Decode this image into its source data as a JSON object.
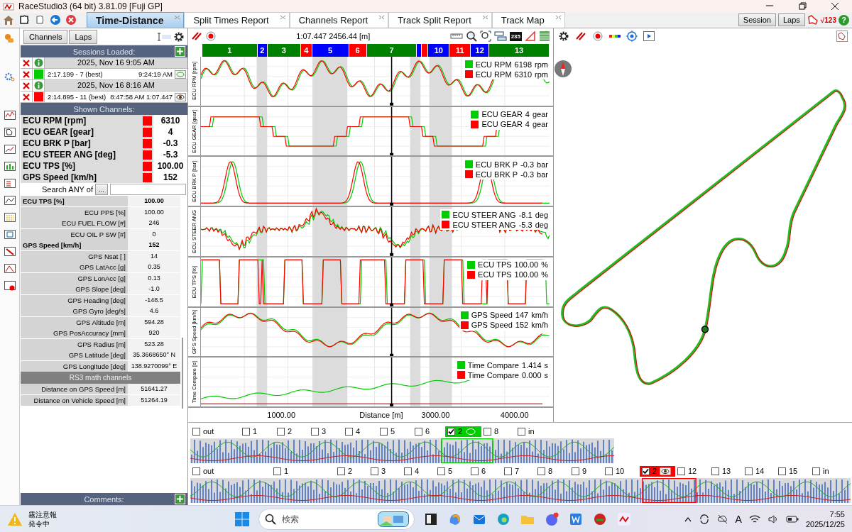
{
  "window": {
    "title": "RaceStudio3 (64 bit) 3.81.09 [Fuji GP]"
  },
  "tabs": [
    {
      "label": "Time-Distance",
      "selected": true
    },
    {
      "label": "Split Times Report",
      "selected": false
    },
    {
      "label": "Channels Report",
      "selected": false
    },
    {
      "label": "Track Split Report",
      "selected": false
    },
    {
      "label": "Track Map",
      "selected": false
    }
  ],
  "top_right": {
    "buttons": [
      "Session",
      "Laps"
    ],
    "math_label": "√123",
    "help_label": "?"
  },
  "left_panel": {
    "buttons": [
      "Channels",
      "Laps"
    ],
    "sessions_header": "Sessions Loaded:",
    "sessions": [
      {
        "kind": "session",
        "date": "2025, Nov 16 9:05 AM"
      },
      {
        "kind": "lap",
        "color": "#00cc00",
        "lap": "2:17.199 - 7 (best)",
        "time": "9:24:19 AM"
      },
      {
        "kind": "session",
        "date": "2025, Nov 16 8:16 AM"
      },
      {
        "kind": "lap",
        "color": "#ff0000",
        "lap": "2:14.895 - 11 (best)",
        "time": "8:47:58 AM 1:07.447"
      }
    ],
    "channels_header": "Shown Channels:",
    "shown_channels": [
      {
        "name": "ECU RPM [rpm]",
        "color": "#ff0000",
        "value": "6310"
      },
      {
        "name": "ECU GEAR [gear]",
        "color": "#ff0000",
        "value": "4"
      },
      {
        "name": "ECU BRK P [bar]",
        "color": "#ff0000",
        "value": "-0.3"
      },
      {
        "name": "ECU STEER ANG [deg]",
        "color": "#ff0000",
        "value": "-5.3"
      },
      {
        "name": "ECU TPS [%]",
        "color": "#ff0000",
        "value": "100.00"
      },
      {
        "name": "GPS Speed [km/h]",
        "color": "#ff0000",
        "value": "152"
      }
    ],
    "search": {
      "label": "Search ANY of",
      "button": "..."
    },
    "channel_values": [
      {
        "kind": "group",
        "name": "ECU TPS [%]",
        "value": "100.00"
      },
      {
        "kind": "item",
        "name": "ECU PPS [%]",
        "value": "100.00"
      },
      {
        "kind": "item",
        "name": "ECU FUEL FLOW [#]",
        "value": "246"
      },
      {
        "kind": "item",
        "name": "ECU OIL P SW [#]",
        "value": "0"
      },
      {
        "kind": "group",
        "name": "GPS Speed [km/h]",
        "value": "152"
      },
      {
        "kind": "item",
        "name": "GPS Nsat [ ]",
        "value": "14"
      },
      {
        "kind": "item",
        "name": "GPS LatAcc [g]",
        "value": "0.35"
      },
      {
        "kind": "item",
        "name": "GPS LonAcc [g]",
        "value": "0.13"
      },
      {
        "kind": "item",
        "name": "GPS Slope [deg]",
        "value": "-1.0"
      },
      {
        "kind": "item",
        "name": "GPS Heading [deg]",
        "value": "-148.5"
      },
      {
        "kind": "item",
        "name": "GPS Gyro [deg/s]",
        "value": "4.6"
      },
      {
        "kind": "item",
        "name": "GPS Altitude [m]",
        "value": "594.28"
      },
      {
        "kind": "item",
        "name": "GPS PosAccuracy [mm]",
        "value": "920"
      },
      {
        "kind": "item",
        "name": "GPS Radius [m]",
        "value": "523.28"
      },
      {
        "kind": "item",
        "name": "GPS Latitude [deg]",
        "value": "35.3668650° N"
      },
      {
        "kind": "item",
        "name": "GPS Longitude [deg]",
        "value": "138.9270099° E"
      },
      {
        "kind": "section",
        "name": "RS3 math channels"
      },
      {
        "kind": "item",
        "name": "Distance on GPS Speed [m]",
        "value": "51641.27"
      },
      {
        "kind": "item",
        "name": "Distance on Vehicle Speed [m]",
        "value": "51264.19"
      }
    ],
    "comments_header": "Comments:"
  },
  "chart": {
    "cursor": "1:07.447 2456.44 [m]",
    "counter": "235",
    "segments": [
      {
        "label": "1",
        "color": "#008000"
      },
      {
        "label": "2",
        "color": "#0000ff"
      },
      {
        "label": "3",
        "color": "#008000"
      },
      {
        "label": "4",
        "color": "#ff0000"
      },
      {
        "label": "5",
        "color": "#0000ff"
      },
      {
        "label": "6",
        "color": "#ff0000"
      },
      {
        "label": "7",
        "color": "#008000"
      },
      {
        "color": "#0000ff"
      },
      {
        "color": "#ff0000"
      },
      {
        "label": "10",
        "color": "#0000ff"
      },
      {
        "label": "11",
        "color": "#ff0000"
      },
      {
        "label": "12",
        "color": "#0000ff"
      },
      {
        "label": "13",
        "color": "#008000"
      }
    ],
    "panels": [
      {
        "kind": "rpm",
        "ylabel": "ECU RPM [rpm]",
        "legend": [
          {
            "color": "#00cc00",
            "channel": "ECU RPM",
            "value": "6198",
            "unit": "rpm"
          },
          {
            "color": "#ff0000",
            "channel": "ECU RPM",
            "value": "6310",
            "unit": "rpm"
          }
        ]
      },
      {
        "kind": "gear",
        "ylabel": "ECU GEAR [gear]",
        "legend": [
          {
            "color": "#00cc00",
            "channel": "ECU GEAR",
            "value": "4",
            "unit": "gear"
          },
          {
            "color": "#ff0000",
            "channel": "ECU GEAR",
            "value": "4",
            "unit": "gear"
          }
        ]
      },
      {
        "kind": "brake",
        "ylabel": "ECU BRK P [bar]",
        "legend": [
          {
            "color": "#00cc00",
            "channel": "ECU BRK P",
            "value": "-0.3",
            "unit": "bar"
          },
          {
            "color": "#ff0000",
            "channel": "ECU BRK P",
            "value": "-0.3",
            "unit": "bar"
          }
        ]
      },
      {
        "kind": "steer",
        "ylabel": "ECU STEER ANG",
        "legend": [
          {
            "color": "#00cc00",
            "channel": "ECU STEER ANG",
            "value": "-8.1",
            "unit": "deg"
          },
          {
            "color": "#ff0000",
            "channel": "ECU STEER ANG",
            "value": "-5.3",
            "unit": "deg"
          }
        ]
      },
      {
        "kind": "tps",
        "ylabel": "ECU TPS [%]",
        "legend": [
          {
            "color": "#00cc00",
            "channel": "ECU TPS",
            "value": "100.00",
            "unit": "%"
          },
          {
            "color": "#ff0000",
            "channel": "ECU TPS",
            "value": "100.00",
            "unit": "%"
          }
        ]
      },
      {
        "kind": "speed",
        "ylabel": "GPS Speed [km/h]",
        "legend": [
          {
            "color": "#00cc00",
            "channel": "GPS Speed",
            "value": "147",
            "unit": "km/h"
          },
          {
            "color": "#ff0000",
            "channel": "GPS Speed",
            "value": "152",
            "unit": "km/h"
          }
        ]
      },
      {
        "kind": "compare",
        "ylabel": "Time Compare [s]",
        "legend": [
          {
            "color": "#00cc00",
            "channel": "Time Compare",
            "value": "1.414",
            "unit": "s"
          },
          {
            "color": "#ff0000",
            "channel": "Time Compare",
            "value": "0.000",
            "unit": "s"
          }
        ]
      }
    ],
    "xticks": [
      "1000.00",
      "3000.00",
      "4000.00"
    ],
    "xlabel": "Distance [m]"
  },
  "lap_strips": [
    {
      "color": "#00cc00",
      "laps": [
        {
          "label": "out",
          "checked": false
        },
        {
          "label": "1",
          "checked": false
        },
        {
          "label": "2",
          "checked": false
        },
        {
          "label": "3",
          "checked": false
        },
        {
          "label": "4",
          "checked": false
        },
        {
          "label": "5",
          "checked": false
        },
        {
          "label": "6",
          "checked": false
        },
        {
          "label": "2",
          "checked": true
        },
        {
          "label": "8",
          "checked": false
        },
        {
          "label": "in",
          "checked": false
        }
      ]
    },
    {
      "color": "#ff0000",
      "laps": [
        {
          "label": "out",
          "checked": false
        },
        {
          "label": "1",
          "checked": false
        },
        {
          "label": "2",
          "checked": false
        },
        {
          "label": "3",
          "checked": false
        },
        {
          "label": "4",
          "checked": false
        },
        {
          "label": "5",
          "checked": false
        },
        {
          "label": "6",
          "checked": false
        },
        {
          "label": "7",
          "checked": false
        },
        {
          "label": "8",
          "checked": false
        },
        {
          "label": "9",
          "checked": false
        },
        {
          "label": "10",
          "checked": false
        },
        {
          "label": "2",
          "checked": true
        },
        {
          "label": "12",
          "checked": false
        },
        {
          "label": "13",
          "checked": false
        },
        {
          "label": "14",
          "checked": false
        },
        {
          "label": "15",
          "checked": false
        },
        {
          "label": "in",
          "checked": false
        }
      ]
    }
  ],
  "taskbar": {
    "weather_title": "霧注意報",
    "weather_status": "発令中",
    "search_placeholder": "検索",
    "ime_label": "A",
    "time": "7:55",
    "date": "2025/12/25"
  }
}
